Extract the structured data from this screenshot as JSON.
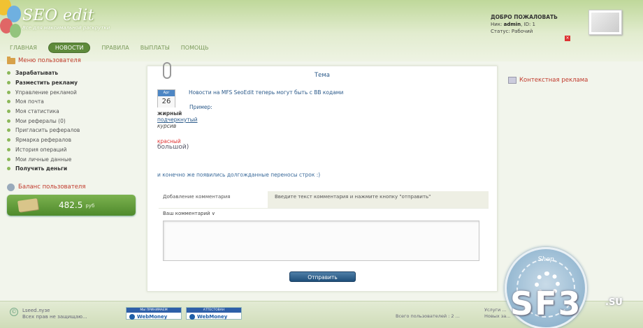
{
  "header": {
    "logo_title": "SEO edit",
    "logo_tagline": "Все для максимальной раскрутки",
    "nav": [
      "ГЛАВНАЯ",
      "НОВОСТИ",
      "ПРАВИЛА",
      "ВЫПЛАТЫ",
      "ПОМОЩЬ"
    ],
    "nav_active": "НОВОСТИ",
    "welcome_title": "ДОБРО ПОЖАЛОВАТЬ",
    "welcome_user_prefix": "Ник:",
    "welcome_user": "admin",
    "welcome_id": ", ID: 1",
    "welcome_status": "Статус: Рабочий",
    "logout_glyph": "×"
  },
  "sidebar": {
    "menu_title": "Меню пользователя",
    "items": [
      {
        "label": "Зарабатывать",
        "bold": true
      },
      {
        "label": "Разместить рекламу",
        "bold": true
      },
      {
        "label": "Управление рекламой",
        "bold": false
      },
      {
        "label": "Моя почта",
        "bold": false
      },
      {
        "label": "Моя статистика",
        "bold": false
      },
      {
        "label": "Мои рефералы (0)",
        "bold": false
      },
      {
        "label": "Пригласить рефералов",
        "bold": false
      },
      {
        "label": "Ярмарка рефералов",
        "bold": false
      },
      {
        "label": "История операций",
        "bold": false
      },
      {
        "label": "Мои личные данные",
        "bold": false
      },
      {
        "label": "Получить деньги",
        "bold": true
      }
    ],
    "balance_title": "Баланс пользователя",
    "balance_amount": "482.5",
    "balance_unit": "руб"
  },
  "main": {
    "title": "Тема",
    "date_month": "Apr",
    "date_day": "26",
    "news_title": "Новости на MFS SeoEdit теперь могут быть с BB кодами",
    "example_label": "Пример:",
    "ex_bold": "жирный",
    "ex_underline": "подчеркнутый",
    "ex_italic": "курсив",
    "ex_red": "красный",
    "ex_big": "большой)",
    "tail_text": "и конечно же появились долгожданные переносы строк :)",
    "form_label": "Добавление комментария",
    "form_hint": "Введите текст комментария и нажмите кнопку \"отправить\"",
    "comment_label": "Ваш комментарий ∨",
    "comment_value": "",
    "send_label": "Отправить"
  },
  "right": {
    "ctx_ads": "Контекстная реклама"
  },
  "footer": {
    "copy_glyph": "©",
    "copy_line1": "Lseed.лузе",
    "copy_line2": "Всех прав не защищаю...",
    "wm1_top": "МЫ ПРИНИМАЕМ",
    "wm2_top": "АТТЕСТОВАН",
    "wm_text": "WebMoney",
    "right_text": "Всего пользователей : 2 ...",
    "right_text2_line1": "Услуги ...",
    "right_text2_line2": "Новых за..."
  },
  "watermark": {
    "shop_text": "Shop",
    "brand": "SF3",
    "tld": ".SU"
  }
}
